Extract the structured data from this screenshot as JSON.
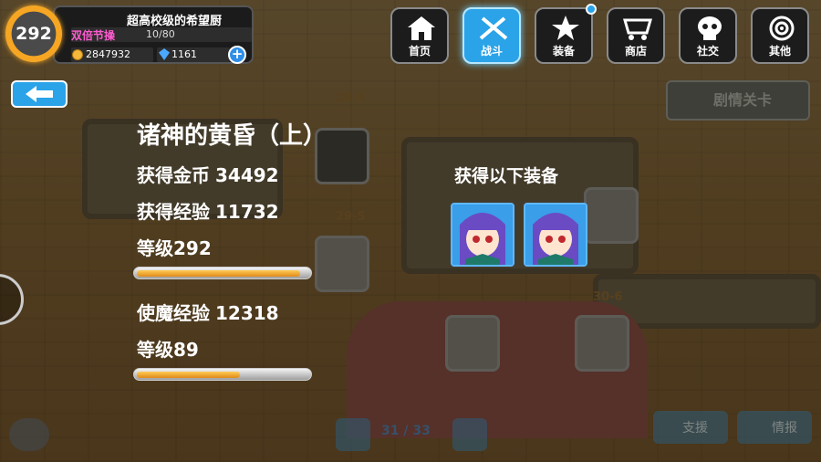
{
  "player": {
    "level": "292",
    "name": "超高校级的希望厨",
    "buff": "双倍节操",
    "stamina": "10/80",
    "coins": "2847932",
    "gems": "1161",
    "plus": "+"
  },
  "nav": [
    {
      "label": "首页",
      "icon": "house-icon"
    },
    {
      "label": "战斗",
      "icon": "crossed-swords-icon"
    },
    {
      "label": "装备",
      "icon": "star-gun-icon"
    },
    {
      "label": "商店",
      "icon": "cart-icon"
    },
    {
      "label": "社交",
      "icon": "skull-icon"
    },
    {
      "label": "其他",
      "icon": "target-icon"
    }
  ],
  "story_button": "剧情关卡",
  "result": {
    "stage_title": "诸神的黄昏（上）",
    "gold_label": "获得金币",
    "gold_value": "34492",
    "exp_label": "获得经验",
    "exp_value": "11732",
    "player_level_label": "等级292",
    "player_exp_progress": 0.95,
    "familiar_exp_label": "使魔经验",
    "familiar_exp_value": "12318",
    "familiar_level_label": "等级89",
    "familiar_exp_progress": 0.6,
    "equip_title": "获得以下装备"
  },
  "bottom": {
    "pager": "31 / 33",
    "support": "支援",
    "intel": "情报"
  },
  "colors": {
    "accent_blue": "#2aa3e8",
    "bar_orange": "#e08a1a",
    "buff_pink": "#ff5bd0"
  }
}
